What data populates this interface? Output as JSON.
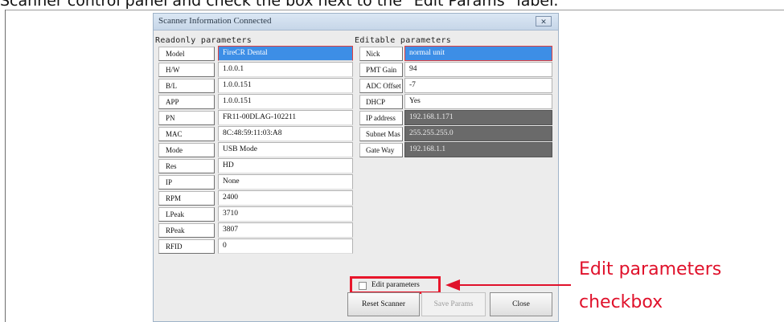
{
  "caption": "Scanner control panel and check the box next to the \"Edit Params\" label.",
  "dialog": {
    "title": "Scanner Information Connected",
    "close_glyph": "✕"
  },
  "readonly": {
    "heading": "Readonly parameters",
    "rows": [
      {
        "label": "Model",
        "value": "FireCR Dental"
      },
      {
        "label": "H/W",
        "value": "1.0.0.1"
      },
      {
        "label": "B/L",
        "value": "1.0.0.151"
      },
      {
        "label": "APP",
        "value": "1.0.0.151"
      },
      {
        "label": "PN",
        "value": "FR11-00DLAG-102211"
      },
      {
        "label": "MAC",
        "value": "8C:48:59:11:03:A8"
      },
      {
        "label": "Mode",
        "value": "USB Mode"
      },
      {
        "label": "Res",
        "value": "HD"
      },
      {
        "label": "IP",
        "value": "None"
      },
      {
        "label": "RPM",
        "value": "2400"
      },
      {
        "label": "LPeak",
        "value": "3710"
      },
      {
        "label": "RPeak",
        "value": "3807"
      },
      {
        "label": "RFID",
        "value": "0"
      }
    ]
  },
  "editable": {
    "heading": "Editable parameters",
    "rows": [
      {
        "label": "Nick",
        "value": "normal unit"
      },
      {
        "label": "PMT Gain",
        "value": "94"
      },
      {
        "label": "ADC Offset",
        "value": "-7"
      },
      {
        "label": "DHCP",
        "value": "Yes"
      },
      {
        "label": "IP address",
        "value": "192.168.1.171"
      },
      {
        "label": "Subnet Mas",
        "value": "255.255.255.0"
      },
      {
        "label": "Gate Way",
        "value": "192.168.1.1"
      }
    ]
  },
  "edit_checkbox_label": "Edit parameters",
  "buttons": {
    "reset": "Reset Scanner",
    "save": "Save Params",
    "close": "Close"
  },
  "annotation": {
    "line1": "Edit parameters",
    "line2": "checkbox"
  },
  "colors": {
    "highlight": "#e8162b",
    "selection": "#3d8ee6"
  }
}
